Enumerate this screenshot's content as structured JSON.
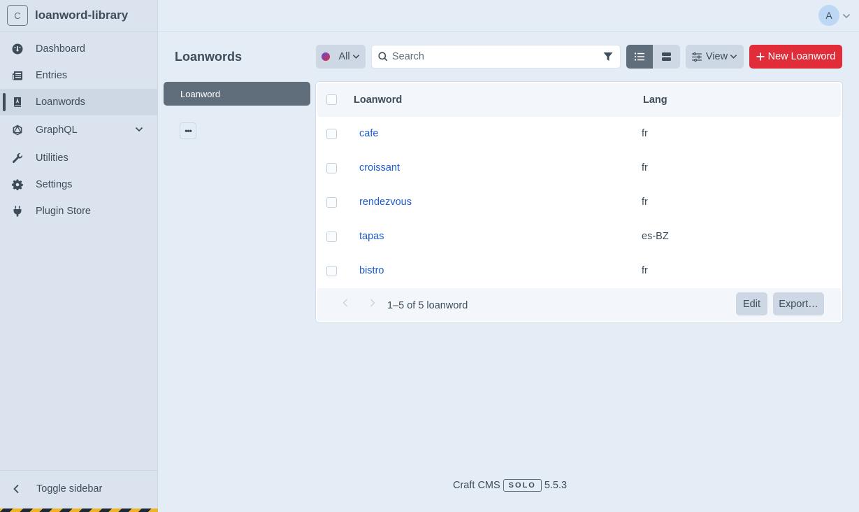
{
  "site": {
    "initial": "C",
    "name": "loanword-library"
  },
  "sidebar": {
    "items": [
      {
        "label": "Dashboard",
        "icon": "gauge-icon",
        "active": false
      },
      {
        "label": "Entries",
        "icon": "newspaper-icon",
        "active": false
      },
      {
        "label": "Loanwords",
        "icon": "book-icon",
        "active": true
      },
      {
        "label": "GraphQL",
        "icon": "graphql-icon",
        "active": false,
        "expandable": true
      },
      {
        "label": "Utilities",
        "icon": "wrench-icon",
        "active": false
      },
      {
        "label": "Settings",
        "icon": "gear-icon",
        "active": false
      },
      {
        "label": "Plugin Store",
        "icon": "plug-icon",
        "active": false
      }
    ],
    "toggle_label": "Toggle sidebar"
  },
  "user": {
    "initial": "A"
  },
  "page": {
    "title": "Loanwords",
    "sources": [
      {
        "label": "Loanword",
        "selected": true
      }
    ],
    "more_label": "•••"
  },
  "toolbar": {
    "status_label": "All",
    "search_placeholder": "Search",
    "search_value": "",
    "view_label": "View",
    "new_label": "New Loanword",
    "accent": "#e12d39"
  },
  "table": {
    "columns": [
      "Loanword",
      "Lang"
    ],
    "rows": [
      {
        "word": "cafe",
        "lang": "fr"
      },
      {
        "word": "croissant",
        "lang": "fr"
      },
      {
        "word": "rendezvous",
        "lang": "fr"
      },
      {
        "word": "tapas",
        "lang": "es-BZ"
      },
      {
        "word": "bistro",
        "lang": "fr"
      }
    ],
    "count_label": "1–5 of 5 loanword",
    "edit_label": "Edit",
    "export_label": "Export…"
  },
  "footer": {
    "product": "Craft CMS",
    "edition": "SOLO",
    "version": "5.5.3"
  }
}
